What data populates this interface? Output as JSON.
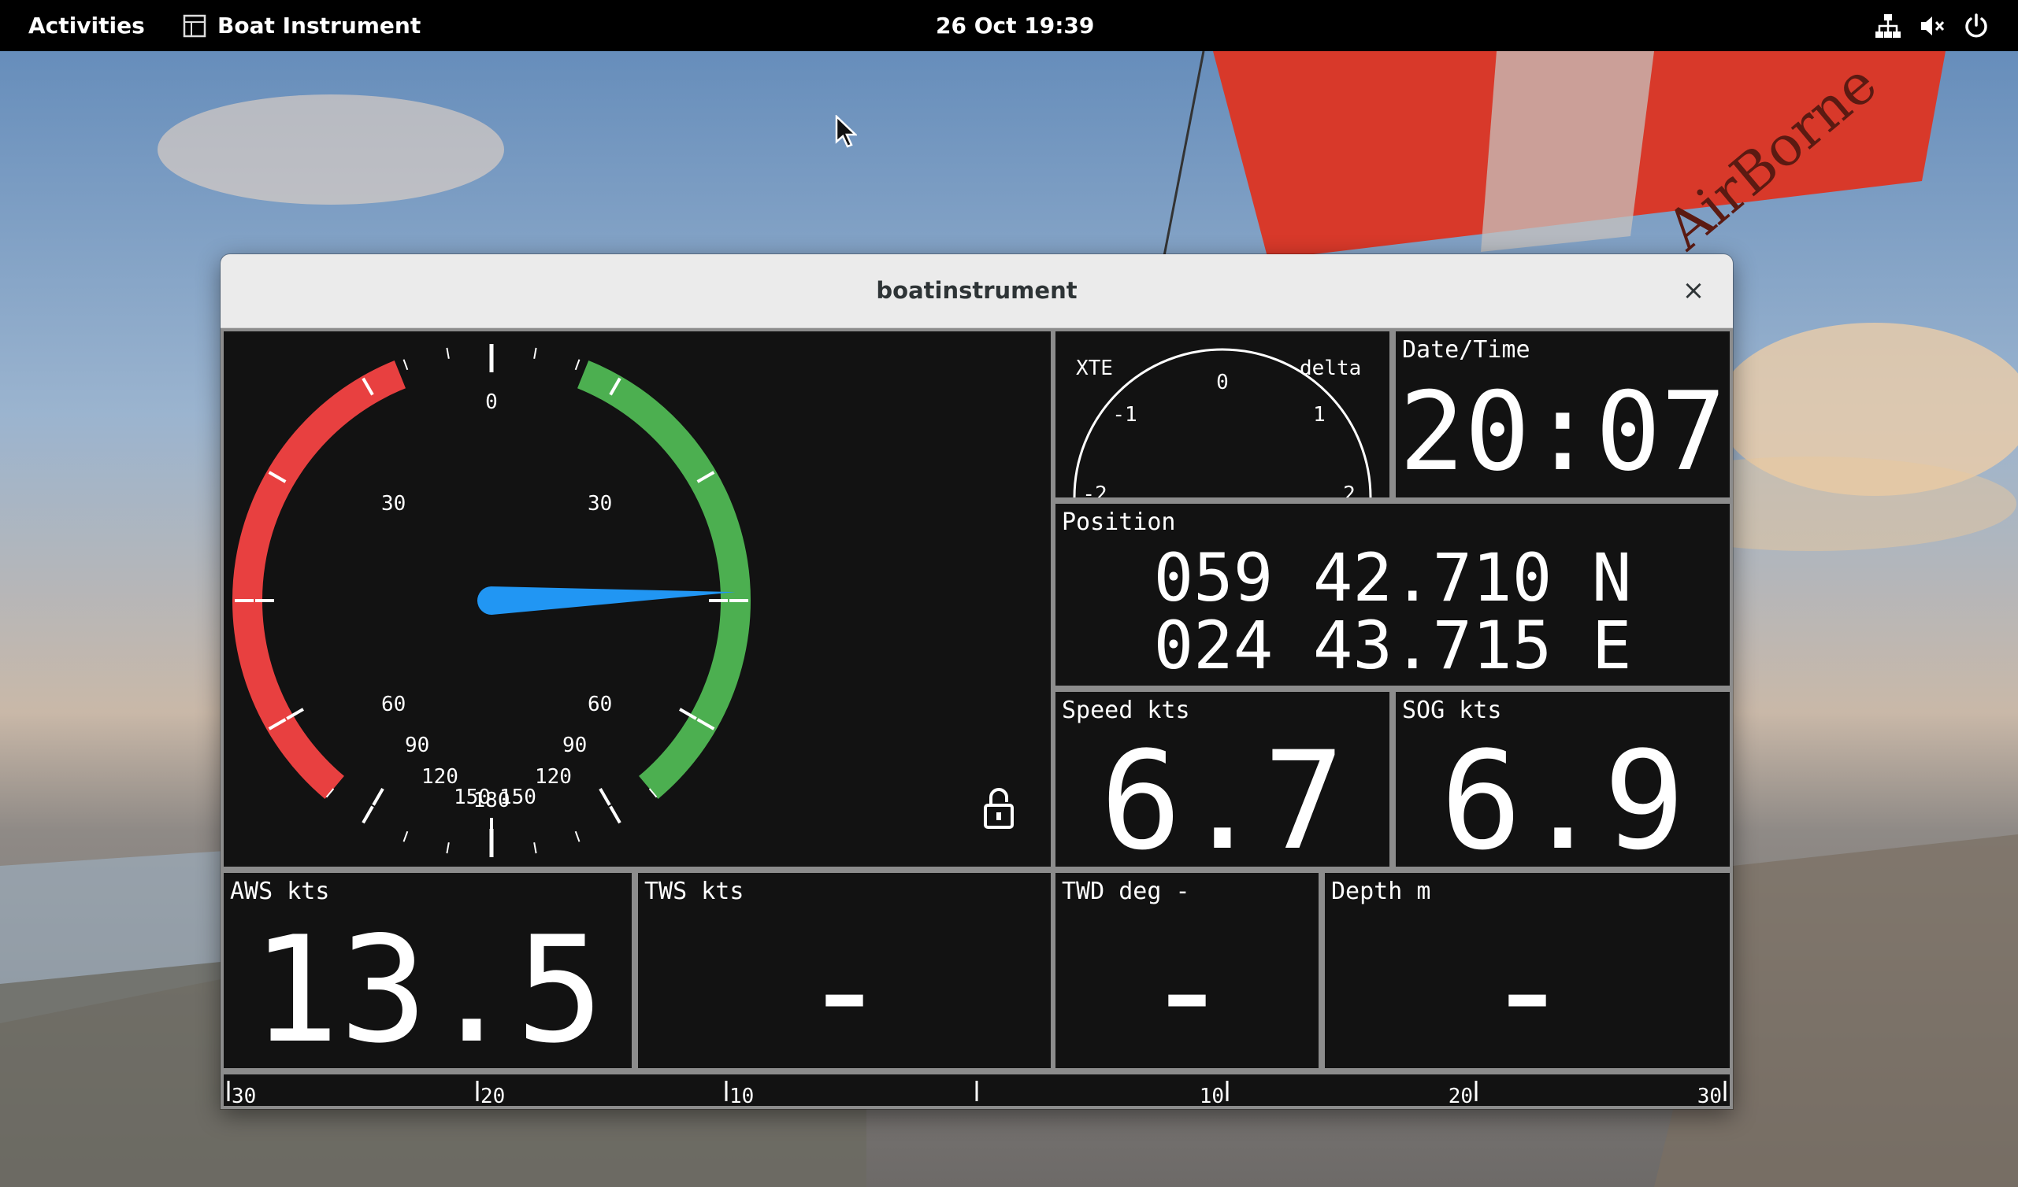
{
  "topbar": {
    "activities": "Activities",
    "app_name": "Boat Instrument",
    "clock": "26 Oct  19:39",
    "icons": [
      "network-icon",
      "volume-muted-icon",
      "power-icon"
    ]
  },
  "desktop": {
    "wing_text": "AirBorne"
  },
  "window": {
    "title": "boatinstrument",
    "close_symbol": "×"
  },
  "wind_gauge": {
    "top_label": "0",
    "bottom_label": "180",
    "left_labels": [
      "30",
      "60",
      "90",
      "120",
      "150"
    ],
    "right_labels": [
      "30",
      "60",
      "90",
      "120",
      "150"
    ],
    "needle_angle_deg": 88,
    "port_color": "#e84040",
    "starboard_color": "#4caf50",
    "needle_color": "#2196f3",
    "lock_icon": "lock-open-icon"
  },
  "xte": {
    "left_label": "XTE",
    "right_label": "delta",
    "scale": [
      "0",
      "-1",
      "1",
      "-2",
      "2"
    ]
  },
  "datetime": {
    "label": "Date/Time",
    "value": "20:07"
  },
  "position": {
    "label": "Position",
    "lat": "059 42.710 N",
    "lon": "024 43.715 E"
  },
  "speed": {
    "label": "Speed kts",
    "value": "6.7"
  },
  "sog": {
    "label": "SOG kts",
    "value": "6.9"
  },
  "aws": {
    "label": "AWS kts",
    "value": "13.5"
  },
  "tws": {
    "label": "TWS kts",
    "value": "-"
  },
  "twd": {
    "label": "TWD deg -",
    "value": "-"
  },
  "depth": {
    "label": "Depth m",
    "value": "-"
  },
  "rudder_scale": {
    "labels": [
      "30",
      "20",
      "10",
      "10",
      "20",
      "30"
    ]
  }
}
